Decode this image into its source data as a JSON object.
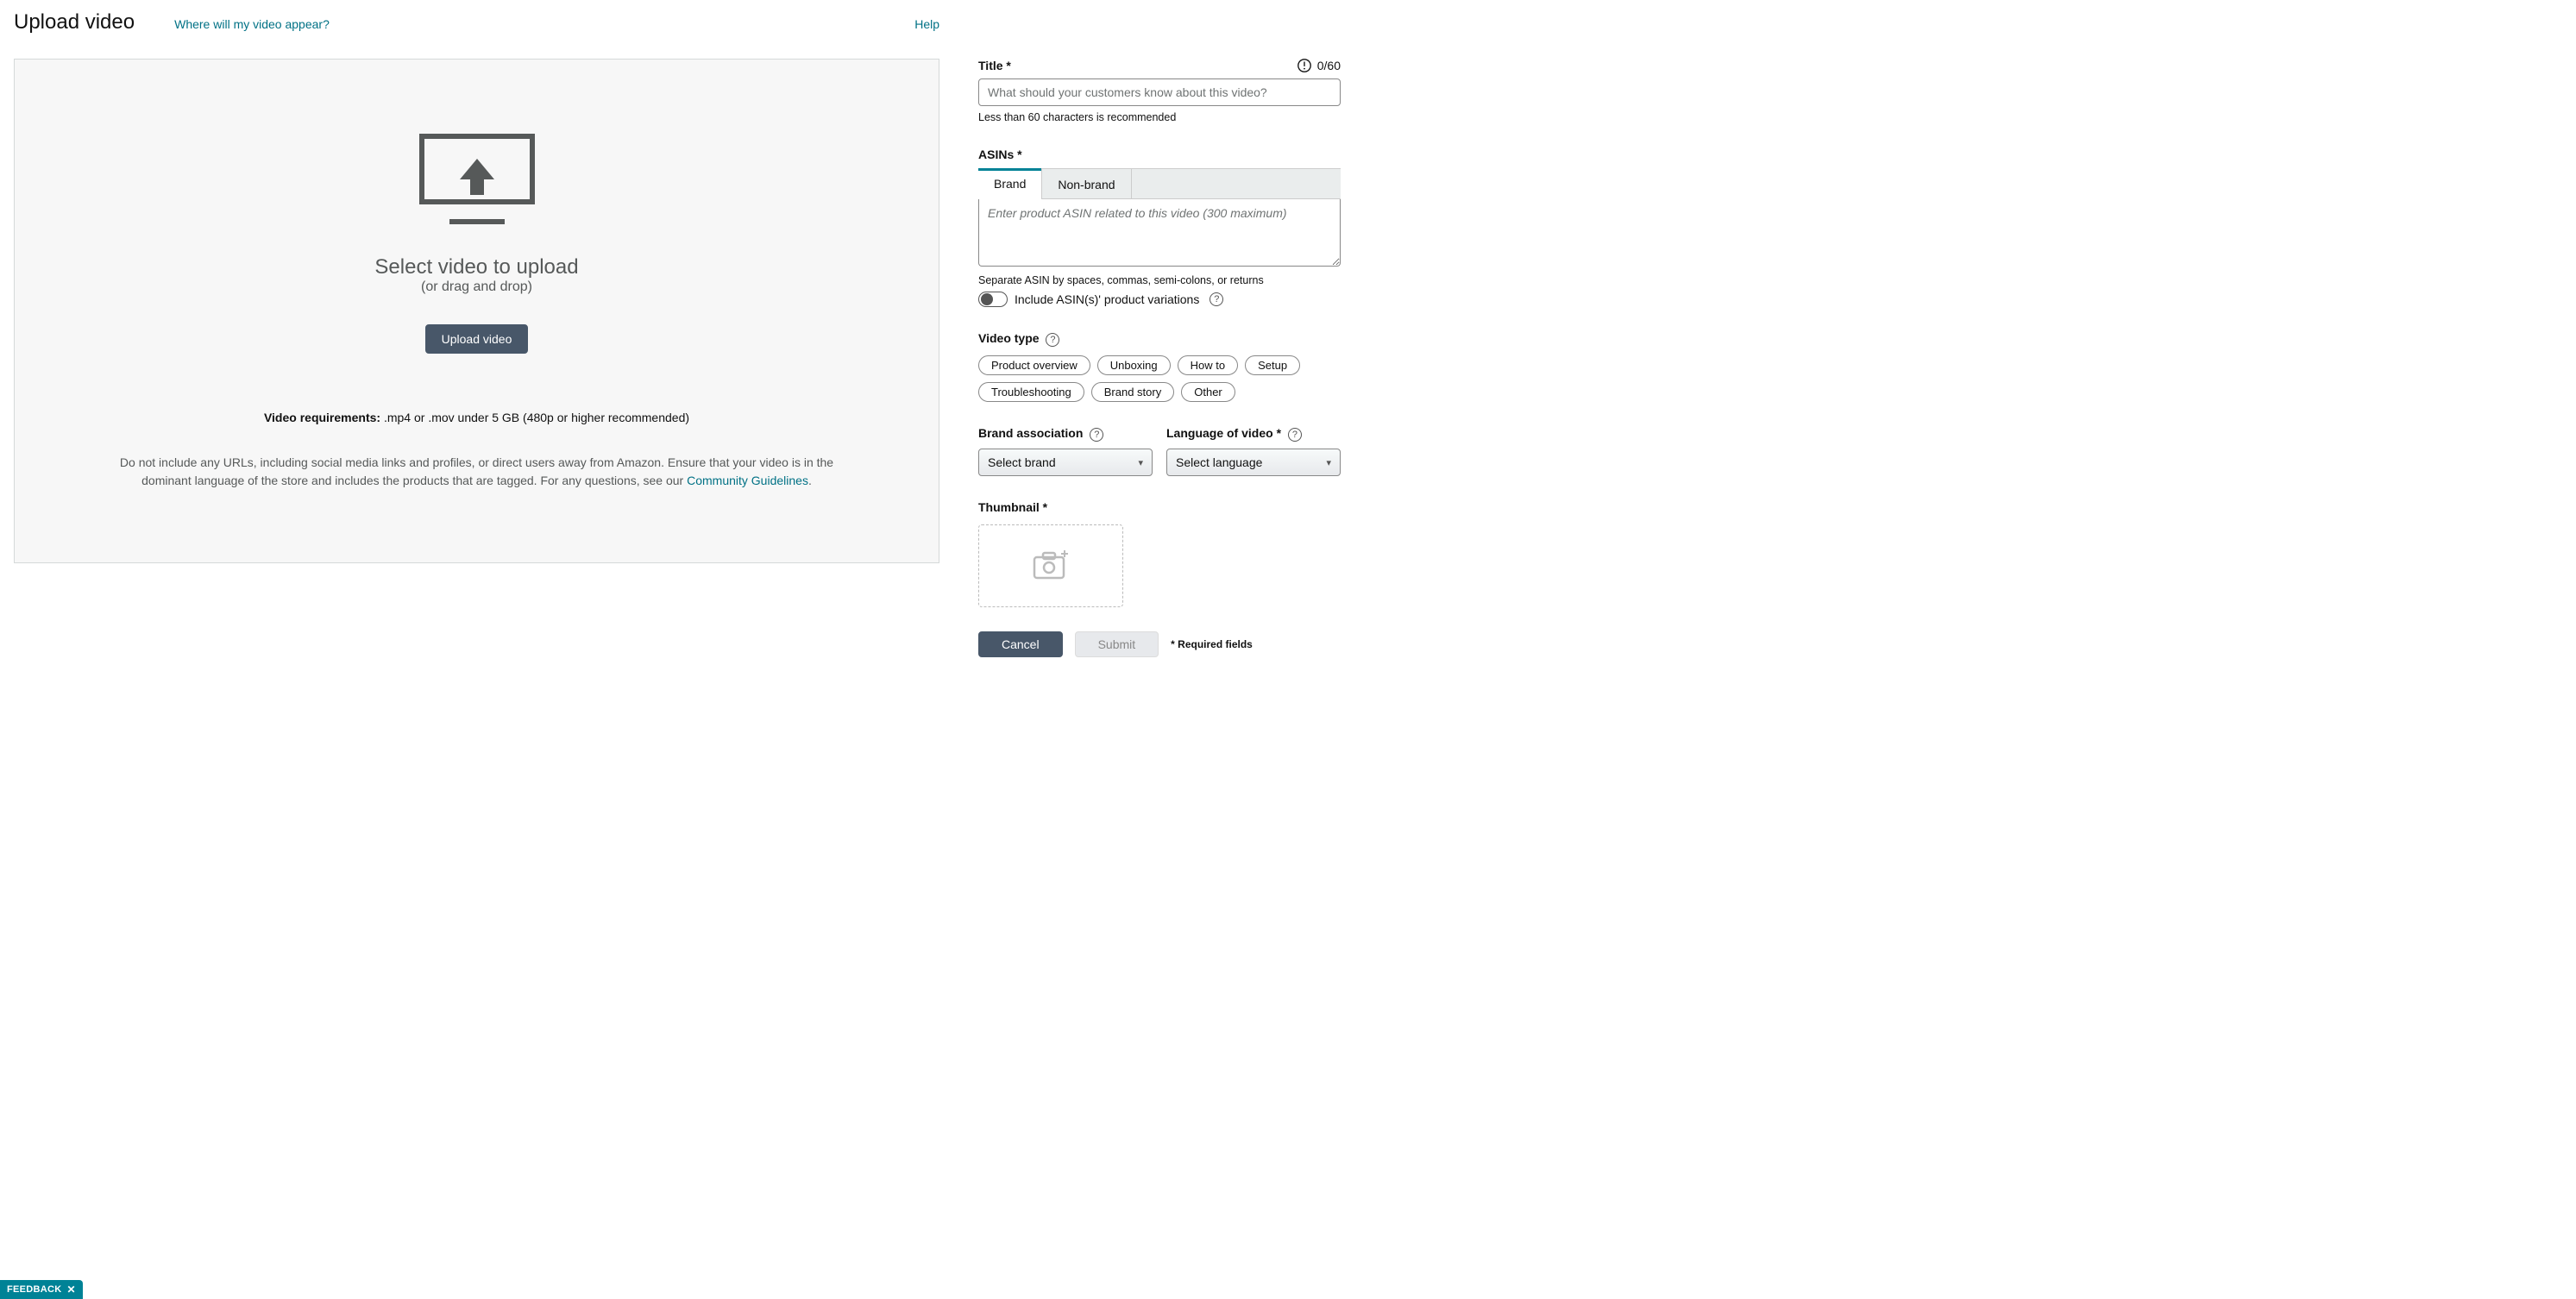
{
  "header": {
    "title": "Upload video",
    "whereLink": "Where will my video appear?",
    "helpLink": "Help"
  },
  "dropzone": {
    "heading": "Select video to upload",
    "sub": "(or drag and drop)",
    "button": "Upload video",
    "reqLabel": "Video requirements:",
    "reqText": " .mp4 or .mov under 5 GB (480p or higher recommended)",
    "notePre": "Do not include any URLs, including social media links and profiles, or direct users away from Amazon. Ensure that your video is in the dominant language of the store and includes the products that are tagged. For any questions, see our ",
    "noteLink": "Community Guidelines",
    "notePost": "."
  },
  "form": {
    "titleLabel": "Title *",
    "titleCounter": "0/60",
    "titlePlaceholder": "What should your customers know about this video?",
    "titleHelper": "Less than 60 characters is recommended",
    "asinsLabel": "ASINs *",
    "tabBrand": "Brand",
    "tabNonBrand": "Non-brand",
    "asinPlaceholder": "Enter product ASIN related to this video (300 maximum)",
    "asinHelper": "Separate ASIN by spaces, commas, semi-colons, or returns",
    "toggleLabel": "Include ASIN(s)' product variations",
    "videoTypeLabel": "Video type",
    "chips": [
      "Product overview",
      "Unboxing",
      "How to",
      "Setup",
      "Troubleshooting",
      "Brand story",
      "Other"
    ],
    "brandLabel": "Brand association",
    "brandPlaceholder": "Select brand",
    "langLabel": "Language of video *",
    "langPlaceholder": "Select language",
    "thumbLabel": "Thumbnail *",
    "cancel": "Cancel",
    "submit": "Submit",
    "requiredNote": "* Required fields"
  },
  "feedback": {
    "label": "FEEDBACK"
  }
}
